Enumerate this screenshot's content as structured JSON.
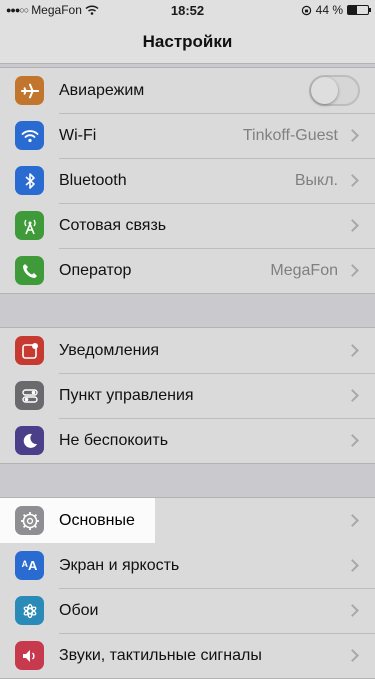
{
  "status_bar": {
    "carrier": "MegaFon",
    "time": "18:52",
    "battery_percent": "44 %",
    "battery_level": 0.44
  },
  "nav": {
    "title": "Настройки"
  },
  "groups": [
    {
      "rows": [
        {
          "label": "Авиарежим",
          "icon": "airplane-icon",
          "icon_color": "#c2752c",
          "toggle": "off"
        },
        {
          "label": "Wi-Fi",
          "value": "Tinkoff-Guest",
          "icon": "wifi-icon",
          "icon_color": "#2a6bd1"
        },
        {
          "label": "Bluetooth",
          "value": "Выкл.",
          "icon": "bluetooth-icon",
          "icon_color": "#2a6bd1"
        },
        {
          "label": "Сотовая связь",
          "icon": "cellular-icon",
          "icon_color": "#3f9b3a"
        },
        {
          "label": "Оператор",
          "value": "MegaFon",
          "icon": "phone-icon",
          "icon_color": "#3f9b3a"
        }
      ]
    },
    {
      "rows": [
        {
          "label": "Уведомления",
          "icon": "notifications-icon",
          "icon_color": "#c73a32"
        },
        {
          "label": "Пункт управления",
          "icon": "control-center-icon",
          "icon_color": "#6a6a6e"
        },
        {
          "label": "Не беспокоить",
          "icon": "moon-icon",
          "icon_color": "#4b3f8a"
        }
      ]
    },
    {
      "rows": [
        {
          "label": "Основные",
          "icon": "gear-icon",
          "icon_color": "#8e8e93",
          "highlighted": true
        },
        {
          "label": "Экран и яркость",
          "icon": "display-brightness-icon",
          "icon_color": "#2a6bd1"
        },
        {
          "label": "Обои",
          "icon": "wallpaper-icon",
          "icon_color": "#2a8ab8"
        },
        {
          "label": "Звуки, тактильные сигналы",
          "icon": "sounds-icon",
          "icon_color": "#c73a4e"
        }
      ]
    }
  ]
}
